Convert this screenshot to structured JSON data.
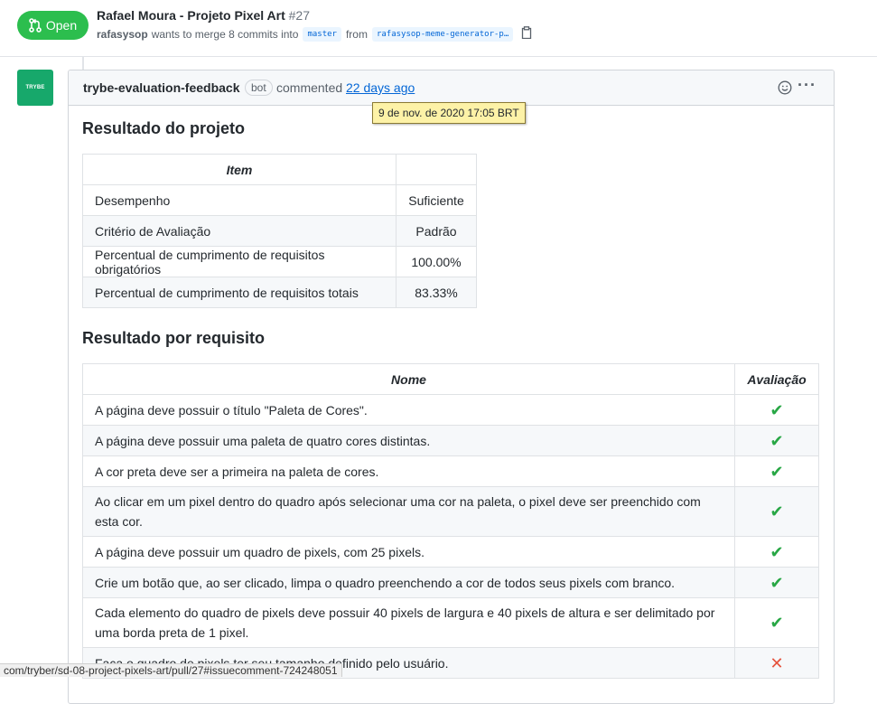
{
  "pr": {
    "state": "Open",
    "title": "Rafael Moura - Projeto Pixel Art",
    "number": "#27",
    "author": "rafasysop",
    "merge_text": "wants to merge 8 commits into",
    "base_branch": "master",
    "from_text": "from",
    "head_branch": "rafasysop-meme-generator-p…"
  },
  "comment": {
    "avatar_text": "TRYBE",
    "author": "trybe-evaluation-feedback",
    "bot_label": "bot",
    "action": "commented",
    "timeago": "22 days ago",
    "tooltip": "9 de nov. de 2020 17:05 BRT",
    "more_label": "···"
  },
  "result": {
    "heading": "Resultado do projeto",
    "headers": [
      "Item",
      ""
    ],
    "rows": [
      {
        "item": "Desempenho",
        "value": "Suficiente"
      },
      {
        "item": "Critério de Avaliação",
        "value": "Padrão"
      },
      {
        "item": "Percentual de cumprimento de requisitos obrigatórios",
        "value": "100.00%"
      },
      {
        "item": "Percentual de cumprimento de requisitos totais",
        "value": "83.33%"
      }
    ]
  },
  "requirements": {
    "heading": "Resultado por requisito",
    "headers": [
      "Nome",
      "Avaliação"
    ],
    "rows": [
      {
        "name": "A página deve possuir o título \"Paleta de Cores\".",
        "mark": "✔"
      },
      {
        "name": "A página deve possuir uma paleta de quatro cores distintas.",
        "mark": "✔"
      },
      {
        "name": "A cor preta deve ser a primeira na paleta de cores.",
        "mark": "✔"
      },
      {
        "name": "Ao clicar em um pixel dentro do quadro após selecionar uma cor na paleta, o pixel deve ser preenchido com esta cor.",
        "mark": "✔"
      },
      {
        "name": "A página deve possuir um quadro de pixels, com 25 pixels.",
        "mark": "✔"
      },
      {
        "name": "Crie um botão que, ao ser clicado, limpa o quadro preenchendo a cor de todos seus pixels com branco.",
        "mark": "✔"
      },
      {
        "name": "Cada elemento do quadro de pixels deve possuir 40 pixels de largura e 40 pixels de altura e ser delimitado por uma borda preta de 1 pixel.",
        "mark": "✔"
      },
      {
        "name": "Faça o quadro de pixels ter seu tamanho definido pelo usuário.",
        "mark": "✕"
      }
    ]
  },
  "status_bar": {
    "url": "com/tryber/sd-08-project-pixels-art/pull/27#issuecomment-724248051"
  }
}
